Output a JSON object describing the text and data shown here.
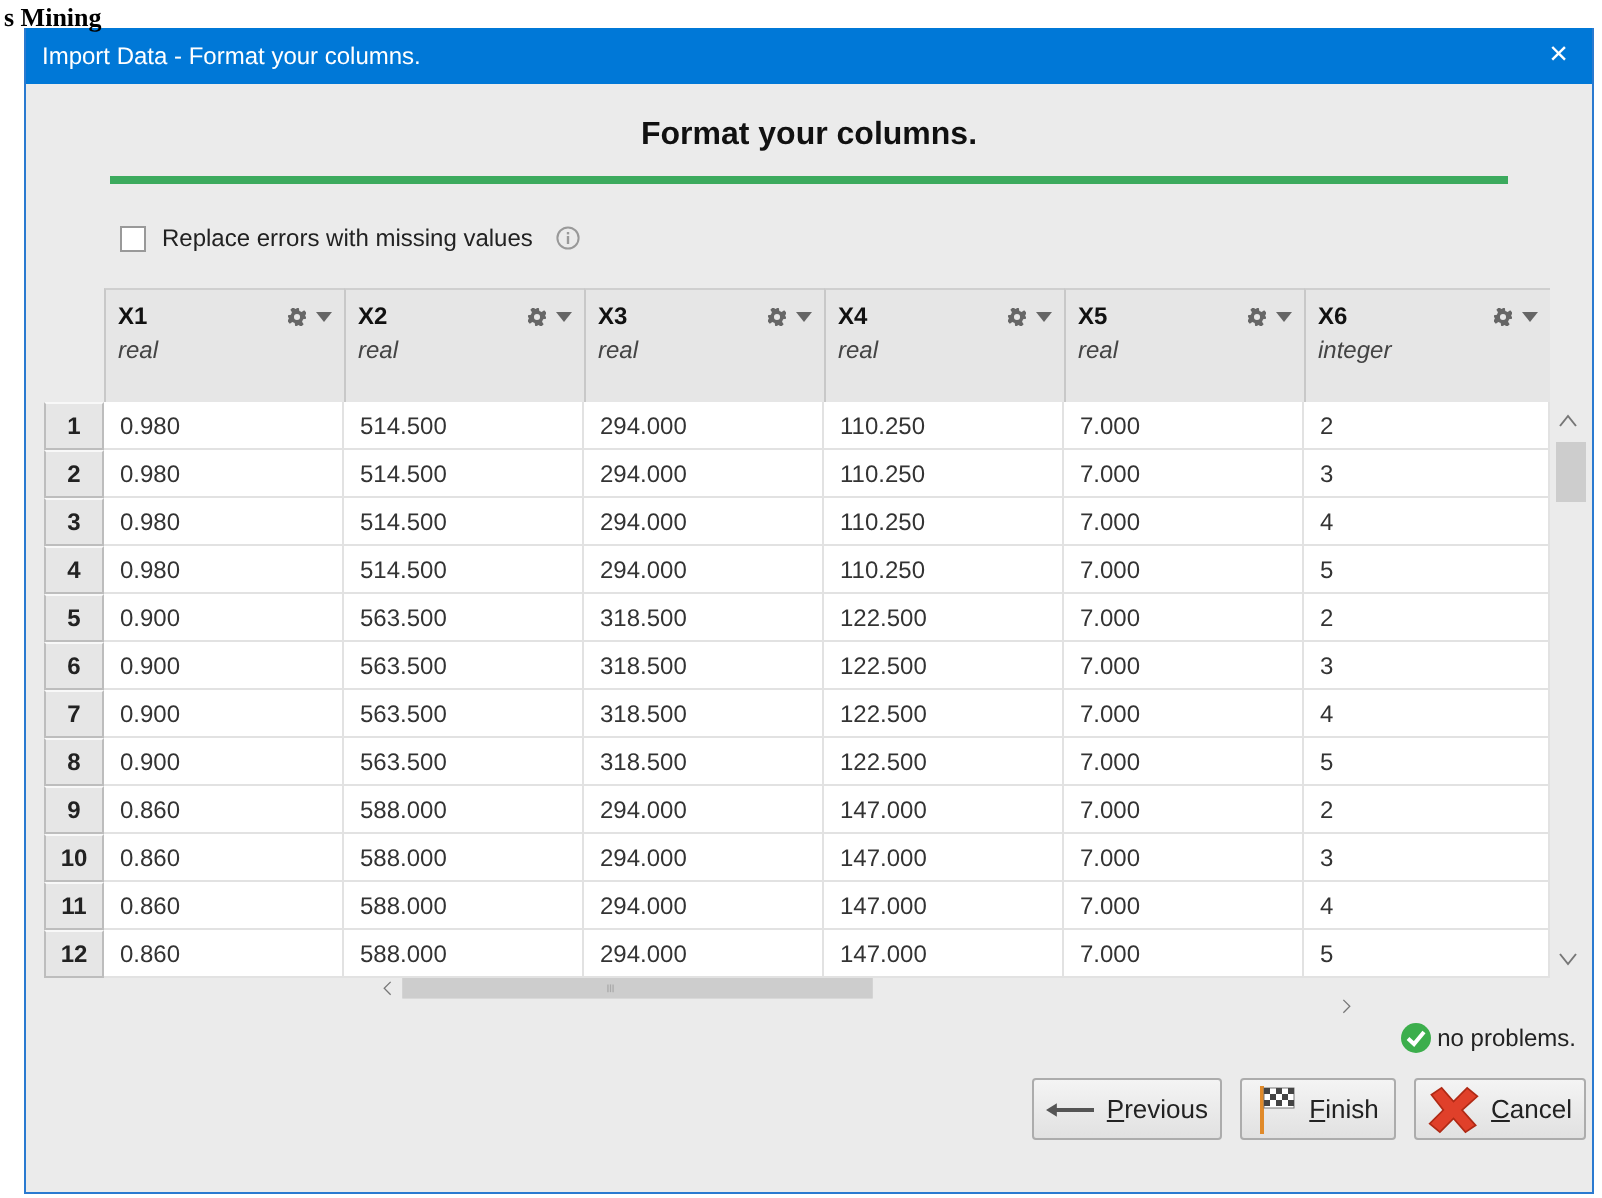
{
  "page_heading": "s Mining",
  "window": {
    "title": "Import Data - Format your columns.",
    "close": "×"
  },
  "heading": "Format your columns.",
  "replace_errors": {
    "label": "Replace errors with missing values",
    "checked": false
  },
  "table": {
    "columns": [
      {
        "name": "X1",
        "type": "real"
      },
      {
        "name": "X2",
        "type": "real"
      },
      {
        "name": "X3",
        "type": "real"
      },
      {
        "name": "X4",
        "type": "real"
      },
      {
        "name": "X5",
        "type": "real"
      },
      {
        "name": "X6",
        "type": "integer"
      }
    ],
    "rows": [
      {
        "number": "1",
        "cells": [
          "0.980",
          "514.500",
          "294.000",
          "110.250",
          "7.000",
          "2"
        ]
      },
      {
        "number": "2",
        "cells": [
          "0.980",
          "514.500",
          "294.000",
          "110.250",
          "7.000",
          "3"
        ]
      },
      {
        "number": "3",
        "cells": [
          "0.980",
          "514.500",
          "294.000",
          "110.250",
          "7.000",
          "4"
        ]
      },
      {
        "number": "4",
        "cells": [
          "0.980",
          "514.500",
          "294.000",
          "110.250",
          "7.000",
          "5"
        ]
      },
      {
        "number": "5",
        "cells": [
          "0.900",
          "563.500",
          "318.500",
          "122.500",
          "7.000",
          "2"
        ]
      },
      {
        "number": "6",
        "cells": [
          "0.900",
          "563.500",
          "318.500",
          "122.500",
          "7.000",
          "3"
        ]
      },
      {
        "number": "7",
        "cells": [
          "0.900",
          "563.500",
          "318.500",
          "122.500",
          "7.000",
          "4"
        ]
      },
      {
        "number": "8",
        "cells": [
          "0.900",
          "563.500",
          "318.500",
          "122.500",
          "7.000",
          "5"
        ]
      },
      {
        "number": "9",
        "cells": [
          "0.860",
          "588.000",
          "294.000",
          "147.000",
          "7.000",
          "2"
        ]
      },
      {
        "number": "10",
        "cells": [
          "0.860",
          "588.000",
          "294.000",
          "147.000",
          "7.000",
          "3"
        ]
      },
      {
        "number": "11",
        "cells": [
          "0.860",
          "588.000",
          "294.000",
          "147.000",
          "7.000",
          "4"
        ]
      },
      {
        "number": "12",
        "cells": [
          "0.860",
          "588.000",
          "294.000",
          "147.000",
          "7.000",
          "5"
        ]
      }
    ]
  },
  "status": "no problems.",
  "buttons": [
    {
      "label": "Previous",
      "kind": "previous"
    },
    {
      "label": "Finish",
      "kind": "finish"
    },
    {
      "label": "Cancel",
      "kind": "cancel"
    }
  ]
}
